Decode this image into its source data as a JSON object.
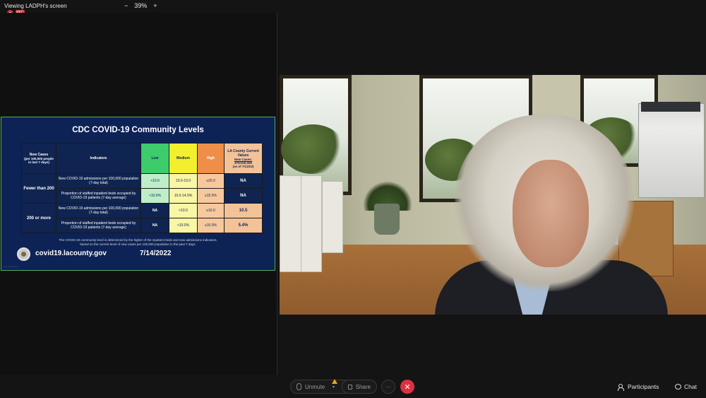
{
  "topbar": {
    "viewing": "Viewing LADPH's screen",
    "zoom_minus": "−",
    "zoom_level": "39%",
    "zoom_plus": "+",
    "rec_badge": "REC"
  },
  "slide": {
    "title": "CDC COVID-19 Community Levels",
    "header": {
      "new_cases": "New Cases",
      "new_cases_sub": "(per 100,000 people in last 7 days)",
      "indicators": "Indicators",
      "low": "Low",
      "medium": "Medium",
      "high": "High",
      "la_current": "LA County Current Values",
      "la_new_cases": "New Cases:",
      "la_new_cases_value": "370/100,000",
      "la_as_of": "(as of 7/13/22)"
    },
    "rows": [
      {
        "group": "Fewer than 200",
        "indicator1": "New COVID-19 admissions per 100,000 population (7-day total)",
        "indicator2": "Proportion of staffed inpatient beds occupied by COVID-19 patients (7-day average)",
        "low1": "<10.0",
        "med1": "10.0-19.9",
        "high1": "≥20.0",
        "la1": "NA",
        "low2": "<10.0%",
        "med2": "10.0-14.9%",
        "high2": "≥15.0%",
        "la2": "NA"
      },
      {
        "group": "200 or more",
        "indicator1": "New COVID-19 admissions per 100,000 population (7-day total)",
        "indicator2": "Proportion of staffed inpatient beds occupied by COVID-19 patients (7-day average)",
        "low1": "NA",
        "med1": "<10.0",
        "high1": "≥10.0",
        "la1": "10.5",
        "low2": "NA",
        "med2": "<10.0%",
        "high2": "≥10.0%",
        "la2": "5.4%"
      }
    ],
    "footnote_line1": "The COVID-19 community level is determined by the higher of the inpatient beds and new admissions indicators,",
    "footnote_line2": "based on the current level of new cases per 100,000 population in the past 7 days.",
    "site": "covid19.lacounty.gov",
    "date": "7/14/2022"
  },
  "controls": {
    "unmute": "Unmute",
    "share": "Share",
    "more": "···",
    "end": "✕",
    "participants": "Participants",
    "chat": "Chat"
  }
}
